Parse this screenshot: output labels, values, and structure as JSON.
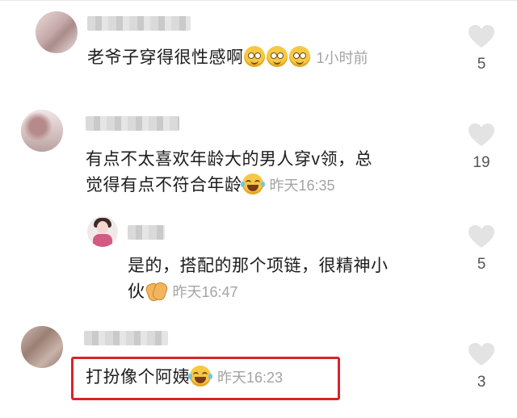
{
  "comments": [
    {
      "text": "老爷子穿得很性感啊",
      "time": "1小时前",
      "likes": "5"
    },
    {
      "text_line1": "有点不太喜欢年龄大的男人穿v领，总",
      "text_line2": "觉得有点不符合年龄",
      "time": "昨天16:35",
      "likes": "19"
    },
    {
      "text_line1": "是的，搭配的那个项链，很精神小",
      "text_line2": "伙",
      "time": "昨天16:47",
      "likes": "5"
    },
    {
      "text": "打扮像个阿姨",
      "time": "昨天16:23",
      "likes": "3"
    }
  ],
  "icons": {
    "like": "heart-icon"
  },
  "colors": {
    "highlight": "#d9232a",
    "time": "#a4a4a4",
    "heart": "#e3e3e3"
  }
}
